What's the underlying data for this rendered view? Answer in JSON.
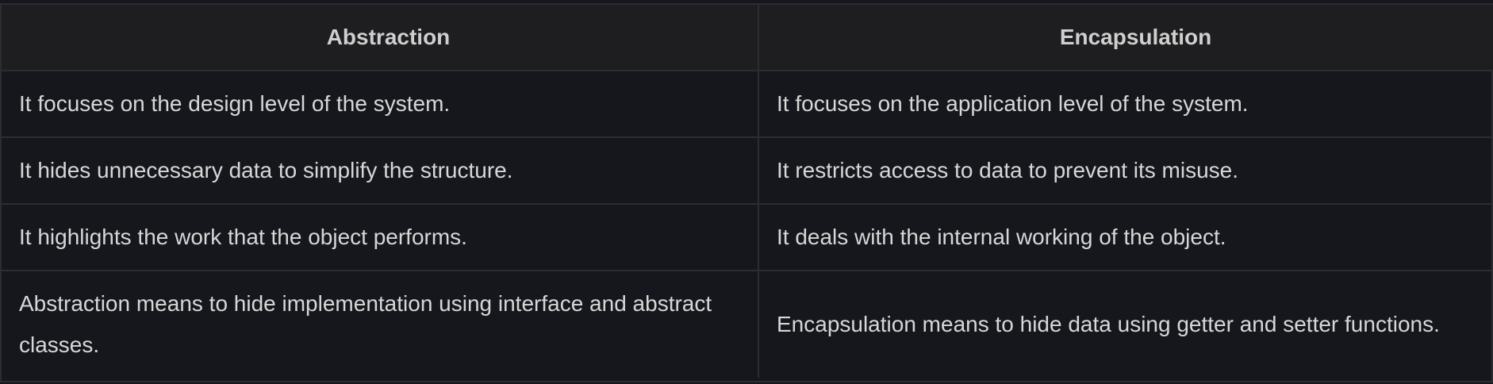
{
  "table": {
    "headers": [
      "Abstraction",
      "Encapsulation"
    ],
    "rows": [
      [
        "It focuses on the design level of the system.",
        "It focuses on the application level of the system."
      ],
      [
        "It hides unnecessary data to simplify the structure.",
        "It restricts access to data to prevent its misuse."
      ],
      [
        "It highlights the work that the object performs.",
        "It deals with the internal working of the object."
      ],
      [
        "Abstraction means to hide implementation using interface and abstract classes.",
        "Encapsulation means to hide data using getter and setter functions."
      ]
    ]
  }
}
